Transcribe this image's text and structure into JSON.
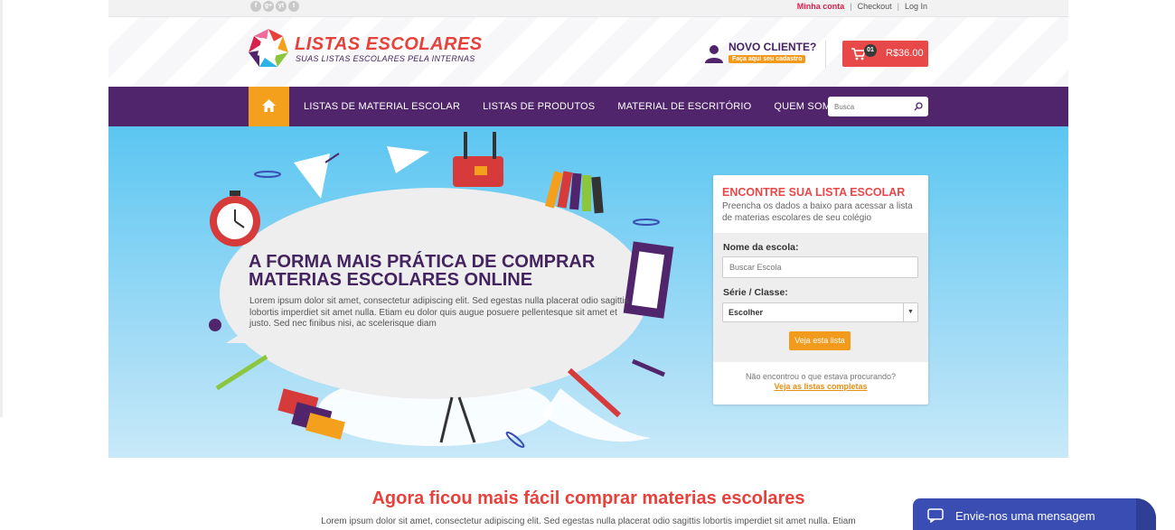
{
  "topbar": {
    "social": [
      "f",
      "g+",
      "yt",
      "t"
    ],
    "links": {
      "account": "Minha conta",
      "sep1": "|",
      "checkout": "Checkout",
      "sep2": "|",
      "login": "Log In"
    }
  },
  "header": {
    "brand_title": "LISTAS ESCOLARES",
    "brand_subtitle": "SUAS LISTAS ESCOLARES PELA INTERNAS",
    "new_client_title": "NOVO CLIENTE?",
    "new_client_badge": "Faça aqui seu cadastro",
    "cart_count": "01",
    "cart_total": "R$36.00"
  },
  "nav": {
    "items": [
      "LISTAS DE MATERIAL ESCOLAR",
      "LISTAS DE PRODUTOS",
      "MATERIAL DE ESCRITÓRIO",
      "QUEM SOMOS"
    ],
    "search_placeholder": "Busca"
  },
  "hero": {
    "heading_line1": "A FORMA MAIS PRÁTICA DE COMPRAR",
    "heading_line2": "MATERIAS ESCOLARES ONLINE",
    "text": "Lorem ipsum dolor sit amet, consectetur adipiscing elit. Sed egestas nulla placerat odio sagittis lobortis imperdiet sit amet nulla. Etiam eu dolor quis augue posuere pellentesque sit amet et justo. Sed nec finibus nisi, ac scelerisque diam"
  },
  "finder": {
    "title": "ENCONTRE SUA LISTA ESCOLAR",
    "description": "Preencha os dados a baixo para acessar a lista de materias escolares de seu colégio",
    "school_label": "Nome da escola:",
    "school_placeholder": "Buscar Escola",
    "grade_label": "Série / Classe:",
    "grade_value": "Escolher",
    "submit_label": "Veja esta lista",
    "not_found_text": "Não encontrou o que estava procurando?",
    "see_all_link": "Veja as listas completas"
  },
  "section": {
    "title": "Agora ficou mais fácil comprar materias escolares",
    "text": "Lorem ipsum dolor sit amet, consectetur adipiscing elit. Sed egestas nulla placerat odio sagittis lobortis imperdiet sit amet nulla. Etiam"
  },
  "chat": {
    "label": "Envie-nos uma mensagem"
  },
  "colors": {
    "purple": "#51256b",
    "orange": "#f4a01c",
    "red": "#e8403b",
    "sky": "#5bc6f1",
    "chat": "#3a4db2"
  }
}
